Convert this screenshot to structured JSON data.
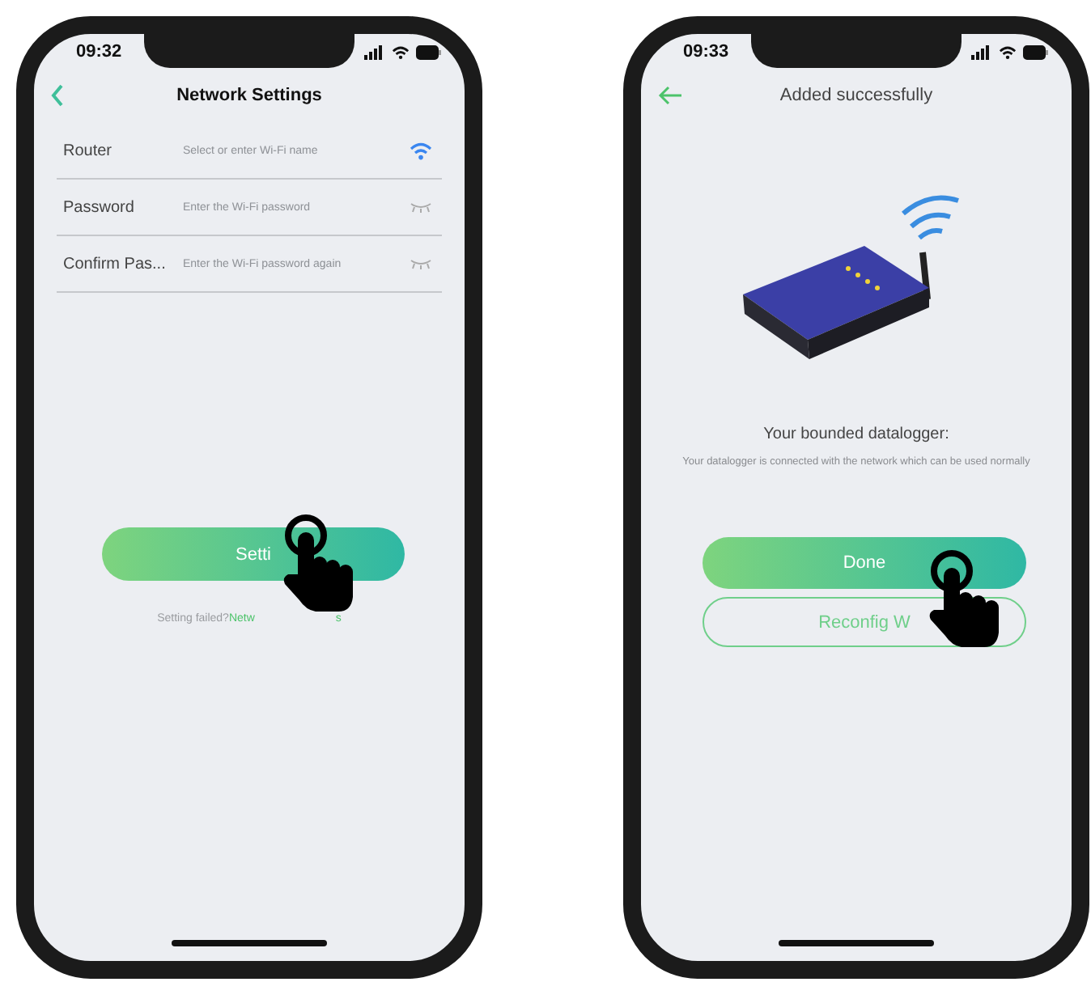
{
  "network_settings_screen": {
    "status_time": "09:32",
    "title": "Network Settings",
    "fields": [
      {
        "label": "Router",
        "placeholder": "Select or enter Wi-Fi name",
        "kind": "wifi"
      },
      {
        "label": "Password",
        "placeholder": "Enter the Wi-Fi password",
        "kind": "password"
      },
      {
        "label": "Confirm Pas...",
        "placeholder": "Enter the Wi-Fi password again",
        "kind": "password"
      }
    ],
    "button": "Setti",
    "hint": "Setting failed?",
    "link": "Netw",
    "link_tail": "s"
  },
  "added_screen": {
    "status_time": "09:33",
    "title": "Added successfully",
    "heading": "Your bounded datalogger:",
    "message": "Your datalogger is connected with the network which can be used normally",
    "primary_button": "Done",
    "secondary_button": "Reconfig W"
  }
}
